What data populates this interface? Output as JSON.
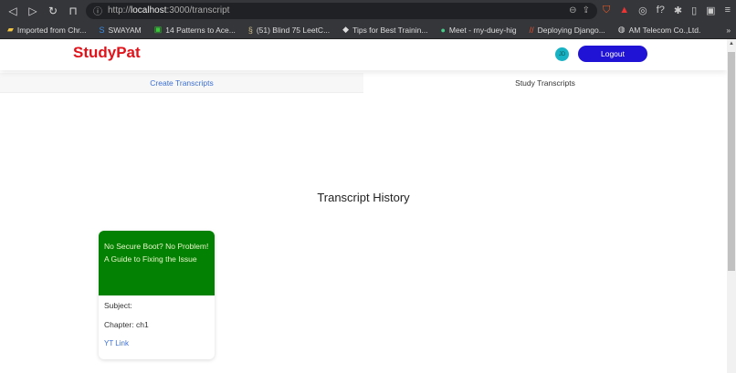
{
  "browser": {
    "url_prefix": "http://",
    "url_host": "localhost",
    "url_rest": ":3000/transcript",
    "bookmarks": [
      "Imported from Chr...",
      "SWAYAM",
      "14 Patterns to Ace...",
      "(51) Blind 75 LeetC...",
      "Tips for Best Trainin...",
      "Meet - rny-duey-hig",
      "Deploying Django...",
      "AM Telecom Co.,Ltd."
    ],
    "more": "»"
  },
  "header": {
    "logo": "StudyPat",
    "avatar": "JD",
    "logout": "Logout"
  },
  "tabs": [
    {
      "label": "Create Transcripts",
      "active": false
    },
    {
      "label": "Study Transcripts",
      "active": true
    }
  ],
  "main": {
    "title": "Transcript History",
    "cards": [
      {
        "title": "No Secure Boot? No Problem! A Guide to Fixing the Issue",
        "subject": "Subject:",
        "chapter": "Chapter: ch1",
        "link": "YT Link"
      }
    ]
  },
  "colors": {
    "brand": "#e0131b",
    "button": "#2113d6",
    "card_header": "#038103",
    "link": "#3b6fd6"
  }
}
